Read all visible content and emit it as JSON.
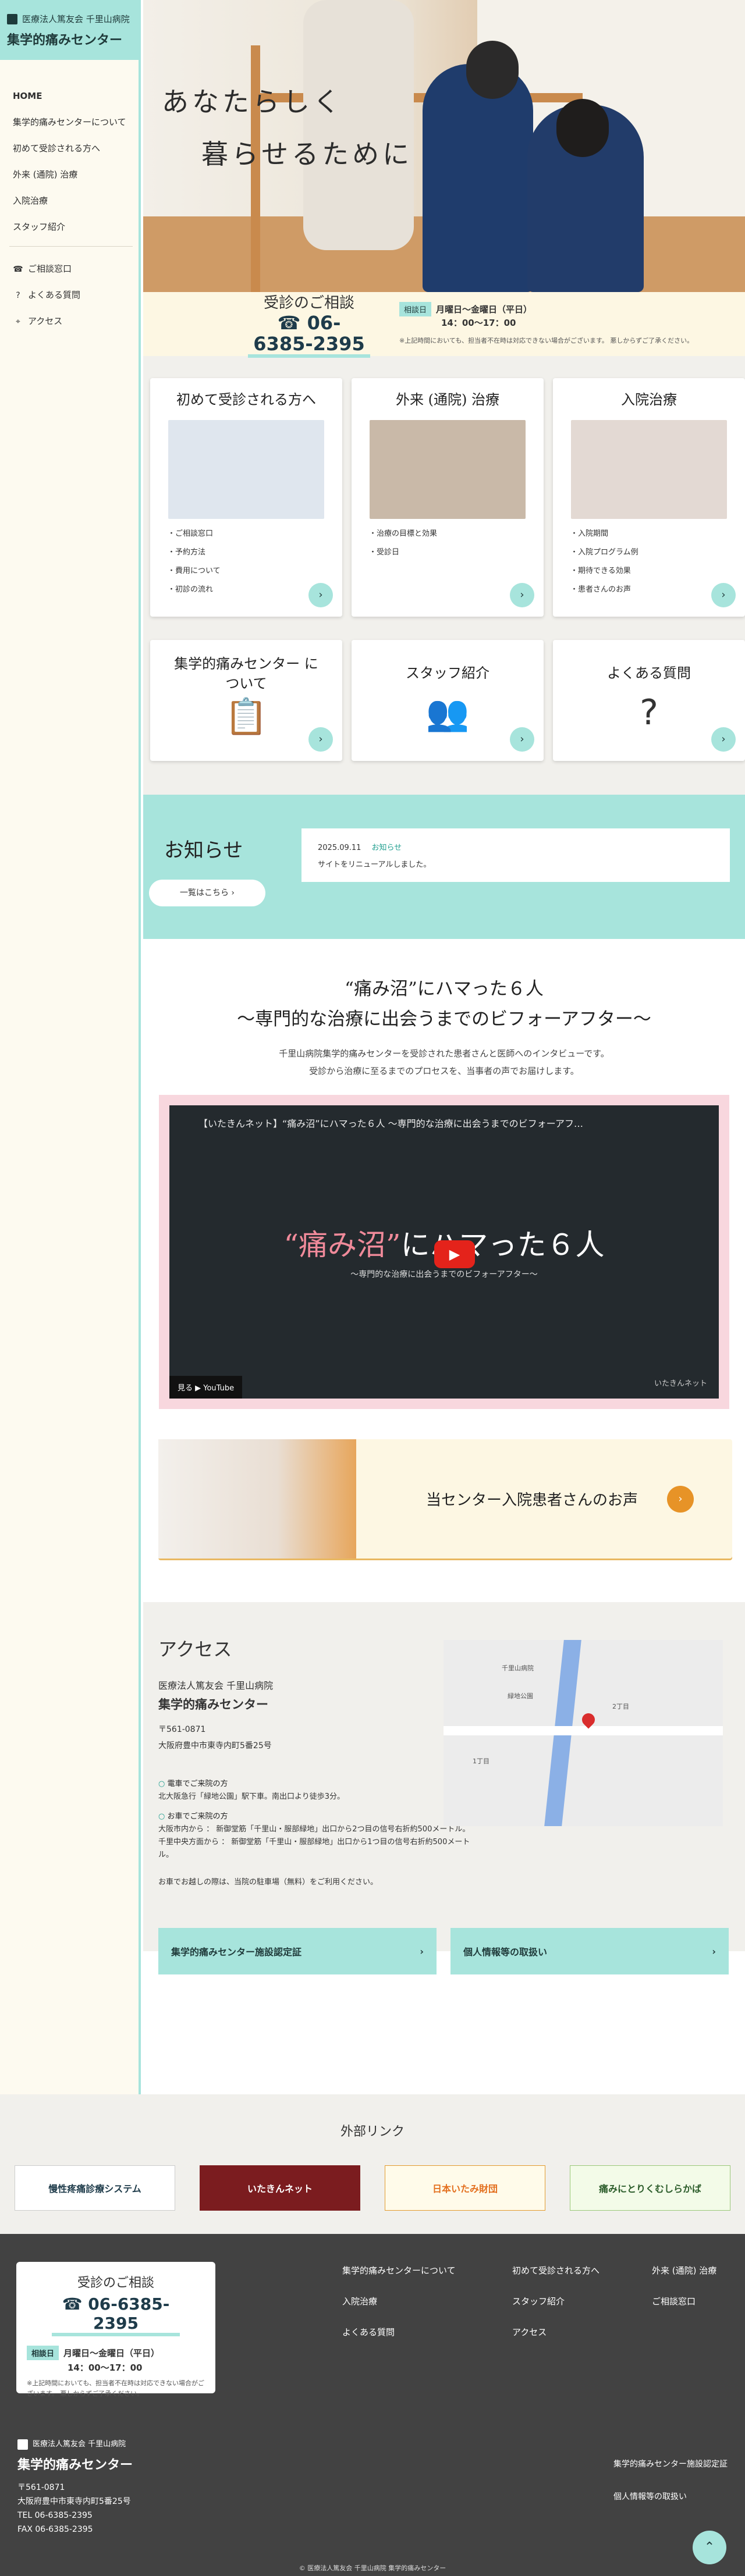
{
  "sidebar": {
    "org": "医療法人篤友会 千里山病院",
    "name": "集学的痛みセンター",
    "nav": [
      "HOME",
      "集学的痛みセンターについて",
      "初めて受診される方へ",
      "外来 (通院) 治療",
      "入院治療",
      "スタッフ紹介"
    ],
    "sub": [
      "ご相談窓口",
      "よくある質問",
      "アクセス"
    ]
  },
  "hero": {
    "line1": "あなたらしく",
    "line2": "暮らせるために"
  },
  "contact": {
    "title": "受診のご相談",
    "tel": "06-6385-2395",
    "tag": "相談日",
    "hours": "月曜日〜金曜日（平日）",
    "time": "14：00〜17：00",
    "note": "※上記時間においても、担当者不在時は対応できない場合がございます。 悪しからずご了承ください。"
  },
  "cards": {
    "first": {
      "title": "初めて受診される方へ",
      "items": [
        "ご相談窓口",
        "予約方法",
        "費用について",
        "初診の流れ"
      ]
    },
    "outpatient": {
      "title": "外来 (通院) 治療",
      "items": [
        "治療の目標と効果",
        "受診日"
      ]
    },
    "inpatient": {
      "title": "入院治療",
      "items": [
        "入院期間",
        "入院プログラム例",
        "期待できる効果",
        "患者さんのお声"
      ]
    },
    "about": {
      "title": "集学的痛みセンター について"
    },
    "staff": {
      "title": "スタッフ紹介"
    },
    "faq": {
      "title": "よくある質問"
    }
  },
  "news": {
    "title": "お知らせ",
    "button": "一覧はこちら",
    "date": "2025.09.11",
    "category": "お知らせ",
    "text": "サイトをリニューアルしました。"
  },
  "interview": {
    "title1": "“痛み沼”にハマった６人",
    "title2": "〜専門的な治療に出会うまでのビフォーアフター〜",
    "desc1": "千里山病院集学的痛みセンターを受診された患者さんと医師へのインタビューです。",
    "desc2": "受診から治療に至るまでのプロセスを、当事者の声でお届けします。",
    "video_title": "【いたきんネット】“痛み沼”にハマった６人 〜専門的な治療に出会うまでのビフォーアフ…",
    "video_main_a": "“痛み沼”",
    "video_main_b": "にハマった６人",
    "video_sub": "〜専門的な治療に出会うまでのビフォーアフター〜",
    "video_watch": "見る ▶ YouTube",
    "video_brand": "いたきんネット"
  },
  "voice": {
    "text": "当センター入院患者さんのお声"
  },
  "access": {
    "title": "アクセス",
    "org": "医療法人篤友会 千里山病院",
    "name": "集学的痛みセンター",
    "zip": "〒561-0871",
    "address": "大阪府豊中市東寺内町5番25号",
    "train_h": "電車でご来院の方",
    "train": "北大阪急行「緑地公園」駅下車。南出口より徒歩3分。",
    "car_h": "お車でご来院の方",
    "car1": "大阪市内から ： 新御堂筋「千里山・服部緑地」出口から2つ目の信号右折約500メートル。",
    "car2": "千里中央方面から ： 新御堂筋「千里山・服部緑地」出口から1つ目の信号右折約500メートル。",
    "parking": "お車でお越しの際は、当院の駐車場（無料）をご利用ください。",
    "map_labels": [
      "千里山病院",
      "緑地公園",
      "2丁目",
      "1丁目"
    ],
    "link1": "集学的痛みセンター施設認定証",
    "link2": "個人情報等の取扱い"
  },
  "external": {
    "title": "外部リンク",
    "banners": [
      "慢性疼痛診療システム",
      "いたきんネット",
      "日本いたみ財団",
      "痛みにとりくむしらかば"
    ]
  },
  "footer": {
    "nav": [
      "集学的痛みセンターについて",
      "初めて受診される方へ",
      "外来 (通院) 治療",
      "入院治療",
      "スタッフ紹介",
      "ご相談窓口",
      "よくある質問",
      "アクセス"
    ],
    "org": "医療法人篤友会 千里山病院",
    "name": "集学的痛みセンター",
    "zip": "〒561-0871",
    "address": "大阪府豊中市東寺内町5番25号",
    "tel": "TEL 06-6385-2395",
    "fax": "FAX 06-6385-2395",
    "right": [
      "集学的痛みセンター施設認定証",
      "個人情報等の取扱い"
    ],
    "copy": "© 医療法人篤友会 千里山病院 集学的痛みセンター"
  }
}
